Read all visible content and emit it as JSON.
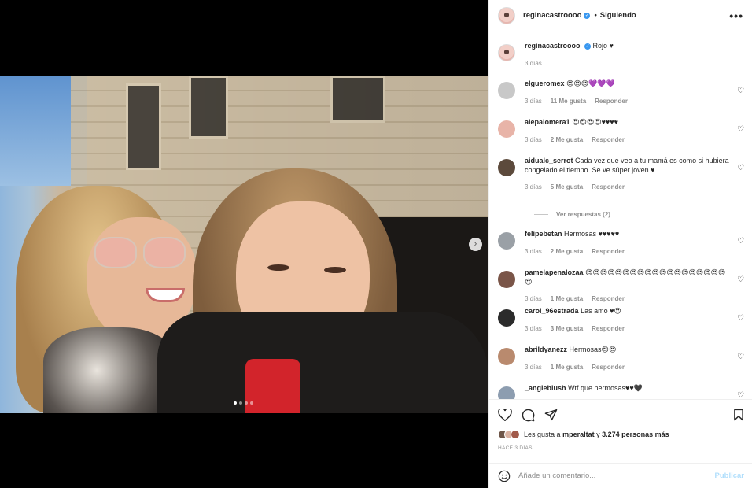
{
  "header": {
    "username": "reginacastroooo",
    "separator": "•",
    "following_label": "Siguiendo",
    "more_label": "•••"
  },
  "media": {
    "next_label": "›",
    "carousel_count": 4,
    "carousel_active": 0
  },
  "caption": {
    "username": "reginacastroooo",
    "text": "Rojo ♥",
    "time": "3 días"
  },
  "comments": [
    {
      "user": "elgueromex",
      "text": "😍😍😍💜💜💜",
      "time": "3 días",
      "likes": "11 Me gusta",
      "reply": "Responder",
      "avatar_color": "#c8c8c8"
    },
    {
      "user": "alepalomera1",
      "text": "😍😍😍😍♥♥♥♥",
      "time": "3 días",
      "likes": "2 Me gusta",
      "reply": "Responder",
      "avatar_color": "#e8b4a8"
    },
    {
      "user": "aidualc_serrot",
      "text": "Cada vez que veo a tu mamá es como si hubiera congelado el tiempo. Se ve súper joven ♥",
      "time": "3 días",
      "likes": "5 Me gusta",
      "reply": "Responder",
      "avatar_color": "#5c4a3c"
    },
    {
      "user": "felipebetan",
      "text": "Hermosas ♥♥♥♥♥",
      "time": "3 días",
      "likes": "2 Me gusta",
      "reply": "Responder",
      "avatar_color": "#9aa0a6"
    },
    {
      "user": "pamelapenalozaa",
      "text": "😍😍😍😍😍😍😍😍😍😍😍😍😍😍😍😍😍😍😍😍",
      "time": "3 días",
      "likes": "1 Me gusta",
      "reply": "Responder",
      "avatar_color": "#7a5548"
    },
    {
      "user": "carol_96estrada",
      "text": "Las amo ♥😍",
      "time": "3 días",
      "likes": "3 Me gusta",
      "reply": "Responder",
      "avatar_color": "#2b2b2b"
    },
    {
      "user": "abrildyanezz",
      "text": "Hermosas😍😍",
      "time": "3 días",
      "likes": "1 Me gusta",
      "reply": "Responder",
      "avatar_color": "#b98a6e"
    },
    {
      "user": "_angieblush",
      "text": "Wtf que hermosas♥♥🖤",
      "time": "",
      "likes": "",
      "reply": "",
      "avatar_color": "#8d9db0"
    }
  ],
  "view_replies": "Ver respuestas (2)",
  "actions": {
    "likes_prefix": "Les gusta a",
    "likes_user": "mperaltat",
    "likes_conj": "y",
    "likes_count": "3.274 personas más",
    "timestamp": "HACE 3 DÍAS"
  },
  "add_comment": {
    "placeholder": "Añade un comentario...",
    "publish_label": "Publicar"
  }
}
